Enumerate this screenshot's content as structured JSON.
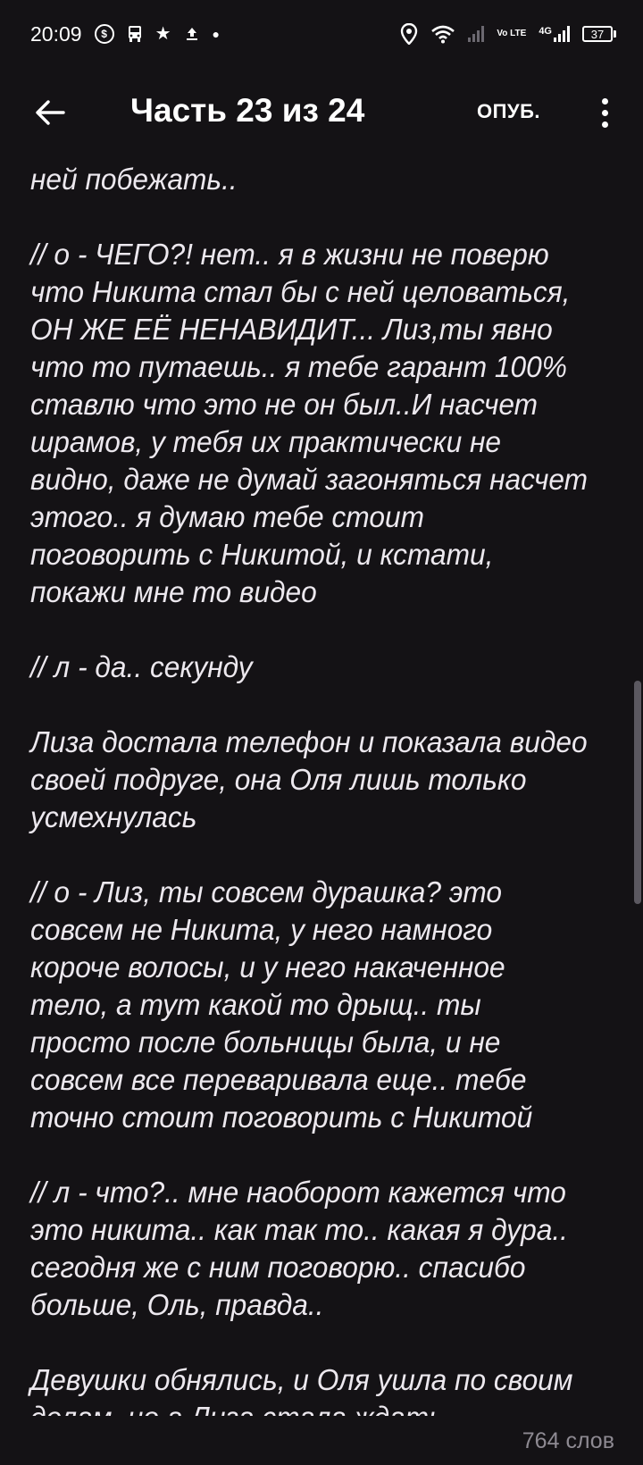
{
  "status_bar": {
    "time": "20:09",
    "lte_label": "Vo LTE",
    "network_label": "4G",
    "battery": "37"
  },
  "app_bar": {
    "title": "Часть 23 из 24",
    "publish_label": "ОПУБ."
  },
  "content": {
    "paragraphs": [
      "ней побежать..",
      "// о - ЧЕГО?! нет.. я в жизни не поверю что Никита стал бы с ней целоваться, ОН ЖЕ ЕЁ НЕНАВИДИТ... Лиз,ты явно что то путаешь.. я тебе гарант 100% ставлю что это не он был..И насчет шрамов, у тебя их практически не видно, даже не думай загоняться насчет этого.. я думаю тебе стоит поговорить с Никитой, и кстати, покажи мне то видео",
      "// л - да.. секунду",
      "Лиза достала телефон и показала видео своей подруге, она Оля лишь только усмехнулась",
      "// о - Лиз, ты совсем дурашка? это совсем не Никита, у него намного короче волосы, и у него накаченное тело, а тут какой то дрыщ.. ты просто после больницы была, и не совсем все переваривала еще.. тебе точно стоит поговорить с Никитой",
      "// л - что?.. мне наоборот кажется что это никита.. как так то.. какая я дура.. сегодня же с ним поговорю.. спасибо больше,  Оль, правда..",
      "Девушки обнялись, и Оля ушла по своим делам, но а Лиза стала ждать"
    ]
  },
  "footer": {
    "word_count": "764 слов"
  }
}
